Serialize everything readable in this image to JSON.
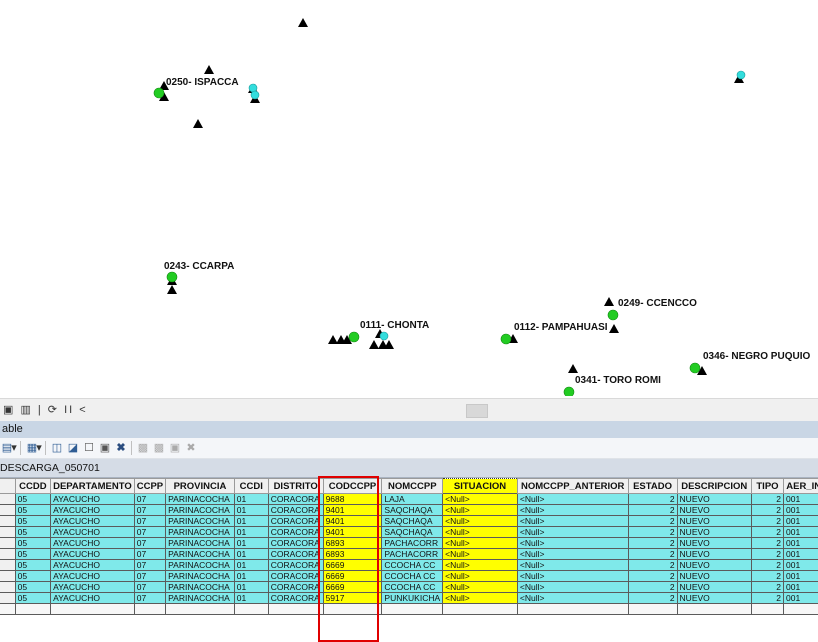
{
  "map": {
    "labels": [
      {
        "id": "0250",
        "text": "0250- ISPACCA"
      },
      {
        "id": "0243",
        "text": "0243- CCARPA"
      },
      {
        "id": "0111",
        "text": "0111- CHONTA"
      },
      {
        "id": "0112",
        "text": "0112- PAMPAHUASI"
      },
      {
        "id": "0249",
        "text": "0249- CCENCCO"
      },
      {
        "id": "0346",
        "text": "0346- NEGRO PUQUIO"
      },
      {
        "id": "0341",
        "text": "0341- TORO ROMI"
      }
    ],
    "colors": {
      "point_green": "#22cc22",
      "point_cyan": "#33dddd",
      "marker_black": "#000000"
    }
  },
  "statusbar": {
    "controls": "▣ ▥ | ⟳ II <"
  },
  "panel": {
    "title": "able"
  },
  "toolbar": {
    "icons": [
      "table-options-icon",
      "related-tables-icon",
      "select-by-attributes-icon",
      "switch-selection-icon",
      "clear-selection-icon",
      "zoom-to-selected-icon",
      "delete-selected-icon",
      "copy-icon",
      "paste-icon",
      "add-field-icon",
      "delete-icon"
    ]
  },
  "table_tab": {
    "name": "DESCARGA_050701"
  },
  "table": {
    "columns": [
      "CCDD",
      "DEPARTAMENTO",
      "CCPP",
      "PROVINCIA",
      "CCDI",
      "DISTRITO",
      "CODCCPP",
      "NOMCCPP",
      "SITUACION",
      "NOMCCPP_ANTERIOR",
      "ESTADO",
      "DESCRIPCION",
      "TIPO",
      "AER_INI"
    ],
    "rows": [
      [
        "05",
        "AYACUCHO",
        "07",
        "PARINACOCHA",
        "01",
        "CORACORA",
        "9688",
        "LAJA",
        "<Null>",
        "<Null>",
        "2",
        "NUEVO",
        "2",
        "001"
      ],
      [
        "05",
        "AYACUCHO",
        "07",
        "PARINACOCHA",
        "01",
        "CORACORA",
        "9401",
        "SAQCHAQA",
        "<Null>",
        "<Null>",
        "2",
        "NUEVO",
        "2",
        "001"
      ],
      [
        "05",
        "AYACUCHO",
        "07",
        "PARINACOCHA",
        "01",
        "CORACORA",
        "9401",
        "SAQCHAQA",
        "<Null>",
        "<Null>",
        "2",
        "NUEVO",
        "2",
        "001"
      ],
      [
        "05",
        "AYACUCHO",
        "07",
        "PARINACOCHA",
        "01",
        "CORACORA",
        "9401",
        "SAQCHAQA",
        "<Null>",
        "<Null>",
        "2",
        "NUEVO",
        "2",
        "001"
      ],
      [
        "05",
        "AYACUCHO",
        "07",
        "PARINACOCHA",
        "01",
        "CORACORA",
        "6893",
        "PACHACORR",
        "<Null>",
        "<Null>",
        "2",
        "NUEVO",
        "2",
        "001"
      ],
      [
        "05",
        "AYACUCHO",
        "07",
        "PARINACOCHA",
        "01",
        "CORACORA",
        "6893",
        "PACHACORR",
        "<Null>",
        "<Null>",
        "2",
        "NUEVO",
        "2",
        "001"
      ],
      [
        "05",
        "AYACUCHO",
        "07",
        "PARINACOCHA",
        "01",
        "CORACORA",
        "6669",
        "CCOCHA CC",
        "<Null>",
        "<Null>",
        "2",
        "NUEVO",
        "2",
        "001"
      ],
      [
        "05",
        "AYACUCHO",
        "07",
        "PARINACOCHA",
        "01",
        "CORACORA",
        "6669",
        "CCOCHA CC",
        "<Null>",
        "<Null>",
        "2",
        "NUEVO",
        "2",
        "001"
      ],
      [
        "05",
        "AYACUCHO",
        "07",
        "PARINACOCHA",
        "01",
        "CORACORA",
        "6669",
        "CCOCHA CC",
        "<Null>",
        "<Null>",
        "2",
        "NUEVO",
        "2",
        "001"
      ],
      [
        "05",
        "AYACUCHO",
        "07",
        "PARINACOCHA",
        "01",
        "CORACORA",
        "5917",
        "PUNKUKICHA",
        "<Null>",
        "<Null>",
        "2",
        "NUEVO",
        "2",
        "001"
      ]
    ],
    "highlight_columns": [
      "CODCCPP",
      "SITUACION"
    ],
    "colors": {
      "row_bg": "#7fe9ea",
      "highlight": "#ffff00",
      "box": "#e00000"
    }
  }
}
